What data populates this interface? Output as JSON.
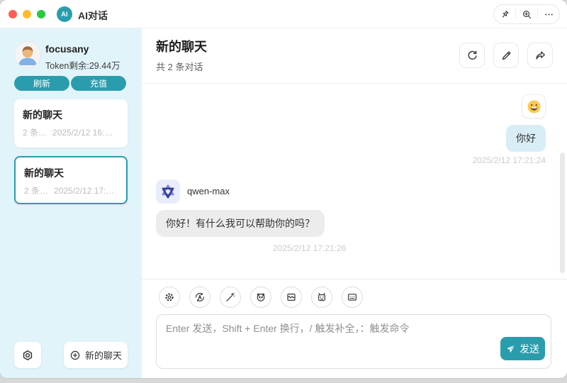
{
  "titlebar": {
    "app_badge": "AI",
    "title": "AI对话"
  },
  "sidebar": {
    "user_name": "focusany",
    "token_text": "Token剩余:29.44万",
    "refresh_button": "刷新",
    "recharge_button": "充值",
    "chats": [
      {
        "title": "新的聊天",
        "count": "2 条…",
        "time": "2025/2/12 16:…"
      },
      {
        "title": "新的聊天",
        "count": "2 条…",
        "time": "2025/2/12 17:…"
      }
    ],
    "new_chat_button": "新的聊天"
  },
  "main": {
    "header": {
      "title": "新的聊天",
      "subtitle": "共 2 条对话"
    },
    "messages": {
      "user": {
        "text": "你好",
        "time": "2025/2/12 17:21:24"
      },
      "assistant": {
        "model": "qwen-max",
        "text": "你好！有什么我可以帮助你的吗？",
        "time": "2025/2/12 17:21:26"
      }
    },
    "composer": {
      "placeholder": "Enter 发送，Shift + Enter 换行，/ 触发补全，：触发命令",
      "send_button": "发送"
    }
  },
  "icons": {
    "titlebar": [
      "pin-icon",
      "zoom-in-icon",
      "more-icon"
    ],
    "header_actions": [
      "refresh-icon",
      "edit-icon",
      "share-icon"
    ],
    "toolbar": [
      "settings-icon",
      "model-cycle-icon",
      "magic-wand-icon",
      "panda-icon",
      "box-icon",
      "robot-icon",
      "subtitle-icon"
    ]
  },
  "colors": {
    "accent": "#2a9dad",
    "sidebar_bg": "#e1f4fa",
    "user_bubble": "#d9edf7",
    "assistant_bubble": "#ececec"
  }
}
